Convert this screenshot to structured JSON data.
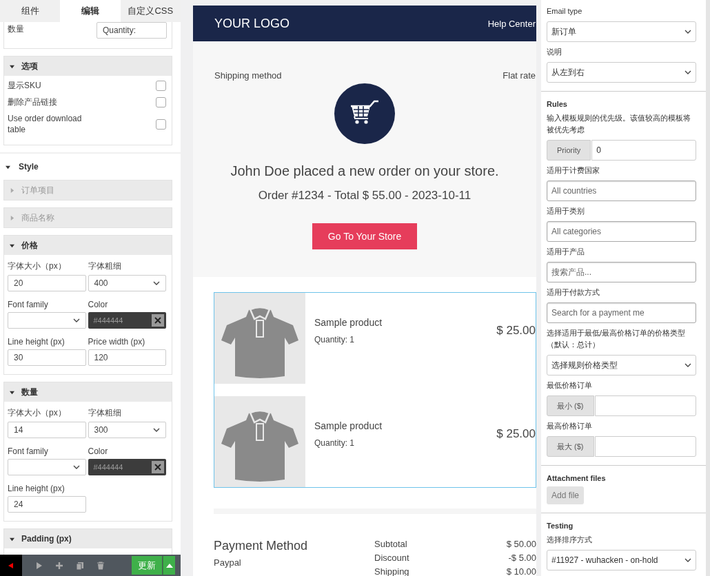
{
  "left_panel": {
    "tabs": [
      {
        "label": "组件",
        "selected": false
      },
      {
        "label": "编辑",
        "selected": true
      },
      {
        "label": "自定义CSS",
        "selected": false
      }
    ],
    "quantity_field": {
      "label": "数量",
      "value": "Quantity:"
    },
    "options": {
      "title": "选项",
      "expanded": true,
      "items": [
        {
          "label": "显示SKU",
          "checked": false
        },
        {
          "label": "删除产品链接",
          "checked": false
        },
        {
          "label": "Use order download table",
          "checked": false
        }
      ]
    },
    "style": {
      "title": "Style",
      "expanded": true,
      "groups": [
        {
          "title": "订单项目",
          "expanded": false
        },
        {
          "title": "商品名称",
          "expanded": false
        },
        {
          "title": "价格",
          "expanded": true,
          "fields": [
            {
              "kind": "input",
              "label": "字体大小（px）",
              "value": "20"
            },
            {
              "kind": "select",
              "label": "字体粗细",
              "value": "400"
            },
            {
              "kind": "select",
              "label": "Font family"
            },
            {
              "kind": "color",
              "label": "Color",
              "placeholder": "#444444"
            },
            {
              "kind": "input",
              "label": "Line height (px)",
              "value": "30"
            },
            {
              "kind": "input",
              "label": "Price width (px)",
              "value": "120"
            }
          ]
        },
        {
          "title": "数量",
          "expanded": true,
          "fields": [
            {
              "kind": "input",
              "label": "字体大小（px）",
              "value": "14"
            },
            {
              "kind": "select",
              "label": "字体粗细",
              "value": "300"
            },
            {
              "kind": "select",
              "label": "Font family"
            },
            {
              "kind": "color",
              "label": "Color",
              "placeholder": "#444444"
            },
            {
              "kind": "input",
              "label": "Line height (px)",
              "value": "24"
            }
          ]
        },
        {
          "title": "Padding (px)",
          "expanded": true
        }
      ]
    },
    "toolbar": {
      "update_button": "更新"
    }
  },
  "preview": {
    "header": {
      "logo": "YOUR LOGO",
      "link": "Help Center"
    },
    "shipping": {
      "label": "Shipping method",
      "value": "Flat rate"
    },
    "heading": "John Doe placed a new order on your store.",
    "order_line": "Order #1234 - Total $ 55.00 - 2023-10-11",
    "cta": "Go To Your Store",
    "items": [
      {
        "name": "Sample product",
        "quantity": "Quantity: 1",
        "price": "$ 25.00"
      },
      {
        "name": "Sample product",
        "quantity": "Quantity: 1",
        "price": "$ 25.00"
      }
    ],
    "payment": {
      "title": "Payment Method",
      "method": "Paypal"
    },
    "totals": [
      {
        "label": "Subtotal",
        "value": "$ 50.00"
      },
      {
        "label": "Discount",
        "value": "-$ 5.00"
      },
      {
        "label": "Shipping",
        "value": "$ 10.00"
      }
    ]
  },
  "right_panel": {
    "email_type": {
      "label": "Email type",
      "value": "新订单"
    },
    "direction": {
      "label": "说明",
      "value": "从左到右"
    },
    "rules": {
      "title": "Rules",
      "description": "输入模板规则的优先级。该值较高的模板将被优先考虑",
      "fields": [
        {
          "kind": "addon",
          "addon": "Priority",
          "value": "0"
        },
        {
          "kind": "input",
          "label": "适用于计费国家",
          "placeholder": "All countries"
        },
        {
          "kind": "input",
          "label": "适用于类别",
          "placeholder": "All categories"
        },
        {
          "kind": "input",
          "label": "适用于产品",
          "placeholder": "搜索产品..."
        },
        {
          "kind": "input",
          "label": "适用于付款方式",
          "placeholder": "Search for a payment me"
        },
        {
          "kind": "select",
          "label": "选择适用于最低/最高价格订单的价格类型（默认：总计）",
          "value": "选择规则价格类型"
        },
        {
          "kind": "addon",
          "label": "最低价格订单",
          "addon": "最小 ($)"
        },
        {
          "kind": "addon",
          "label": "最高价格订单",
          "addon": "最大 ($)"
        }
      ]
    },
    "attachments": {
      "title": "Attachment files",
      "button": "Add file"
    },
    "testing": {
      "title": "Testing",
      "label": "选择排序方式",
      "value": "#11927 - wuhacken - on-hold"
    }
  }
}
